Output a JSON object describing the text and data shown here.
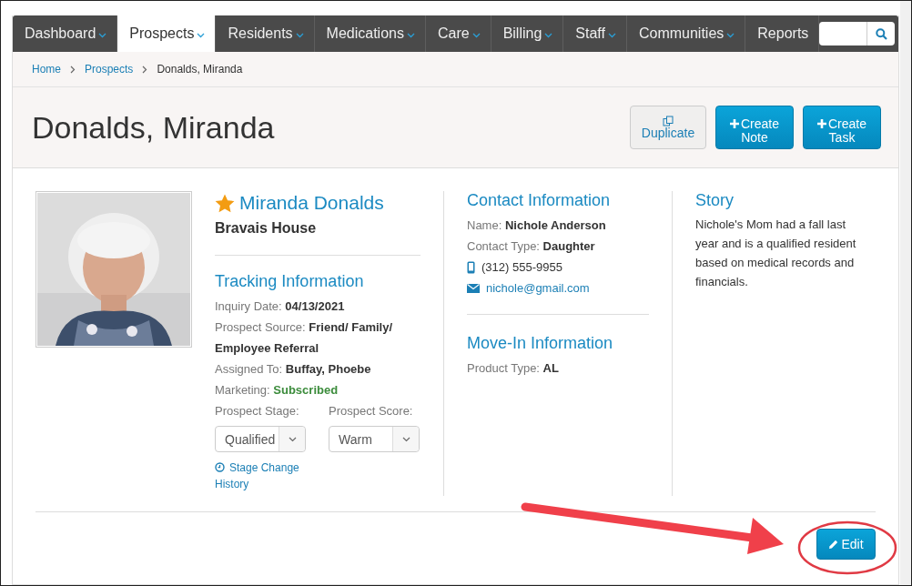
{
  "nav": {
    "items": [
      {
        "label": "Dashboard",
        "selected": false,
        "dropdown": true
      },
      {
        "label": "Prospects",
        "selected": true,
        "dropdown": true
      },
      {
        "label": "Residents",
        "selected": false,
        "dropdown": true
      },
      {
        "label": "Medications",
        "selected": false,
        "dropdown": true
      },
      {
        "label": "Care",
        "selected": false,
        "dropdown": true
      },
      {
        "label": "Billing",
        "selected": false,
        "dropdown": true
      },
      {
        "label": "Staff",
        "selected": false,
        "dropdown": true
      },
      {
        "label": "Communities",
        "selected": false,
        "dropdown": true
      },
      {
        "label": "Reports",
        "selected": false,
        "dropdown": false
      }
    ]
  },
  "breadcrumb": [
    {
      "label": "Home",
      "link": true
    },
    {
      "label": "Prospects",
      "link": true
    },
    {
      "label": "Donalds, Miranda",
      "link": false
    }
  ],
  "title": "Donalds, Miranda",
  "actions": [
    {
      "kind": "duplicate",
      "label": "Duplicate"
    },
    {
      "kind": "create",
      "label": "Create Note"
    },
    {
      "kind": "create",
      "label": "Create Task"
    }
  ],
  "profile": {
    "name": "Miranda Donalds",
    "starred": true,
    "community": "Bravais House"
  },
  "tracking": {
    "title": "Tracking Information",
    "fields": [
      {
        "label": "Inquiry Date:",
        "value": "04/13/2021",
        "kind": "text"
      },
      {
        "label": "Prospect Source:",
        "value": "Friend/ Family/ Employee Referral",
        "kind": "text"
      },
      {
        "label": "Assigned To:",
        "value": "Buffay, Phoebe",
        "kind": "text"
      },
      {
        "label": "Marketing:",
        "value": "Subscribed",
        "kind": "status"
      }
    ],
    "selects": [
      {
        "label": "Prospect Stage:",
        "value": "Qualified"
      },
      {
        "label": "Prospect Score:",
        "value": "Warm"
      }
    ],
    "history_link": "Stage Change History"
  },
  "contact": {
    "title": "Contact Information",
    "fields": [
      {
        "label": "Name:",
        "value": "Nichole Anderson"
      },
      {
        "label": "Contact Type:",
        "value": "Daughter"
      }
    ],
    "phone": "(312) 555-9955",
    "email": "nichole@gmail.com"
  },
  "move_in": {
    "title": "Move-In Information",
    "fields": [
      {
        "label": "Product Type:",
        "value": "AL"
      }
    ]
  },
  "story": {
    "title": "Story",
    "text": "Nichole's Mom had a fall last year and is a qualified resident based on medical records and financials."
  },
  "edit_button": {
    "label": "Edit"
  }
}
